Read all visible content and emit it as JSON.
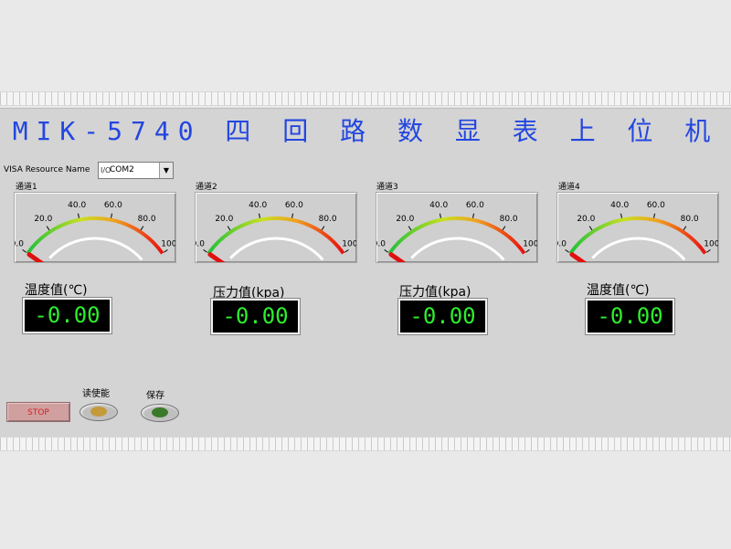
{
  "title": "MIK-5740 四 回 路 数 显 表 上 位 机",
  "visa": {
    "label": "VISA Resource Name",
    "icon": "I/O",
    "value": "COM2"
  },
  "gauges": [
    {
      "label": "通道1",
      "ticks": [
        "0.0",
        "20.0",
        "40.0",
        "60.0",
        "80.0",
        "100.0"
      ],
      "value": 0
    },
    {
      "label": "通道2",
      "ticks": [
        "0.0",
        "20.0",
        "40.0",
        "60.0",
        "80.0",
        "100.0"
      ],
      "value": 0
    },
    {
      "label": "通道3",
      "ticks": [
        "0.0",
        "20.0",
        "40.0",
        "60.0",
        "80.0",
        "100.0"
      ],
      "value": 0
    },
    {
      "label": "通道4",
      "ticks": [
        "0.0",
        "20.0",
        "40.0",
        "60.0",
        "80.0",
        "100.0"
      ],
      "value": 0
    }
  ],
  "readings": [
    {
      "label": "温度值(℃)",
      "value": "-0.00"
    },
    {
      "label": "压力值(kpa)",
      "value": "-0.00"
    },
    {
      "label": "压力值(kpa)",
      "value": "-0.00"
    },
    {
      "label": "温度值(℃)",
      "value": "-0.00"
    }
  ],
  "controls": {
    "stop_label": "STOP",
    "read_enable_label": "读使能",
    "save_label": "保存"
  },
  "colors": {
    "title": "#2346e0",
    "display_text": "#2dee2d",
    "needle": "#e01010",
    "read_led": "#c49a3a",
    "save_led": "#3a7a2a"
  }
}
